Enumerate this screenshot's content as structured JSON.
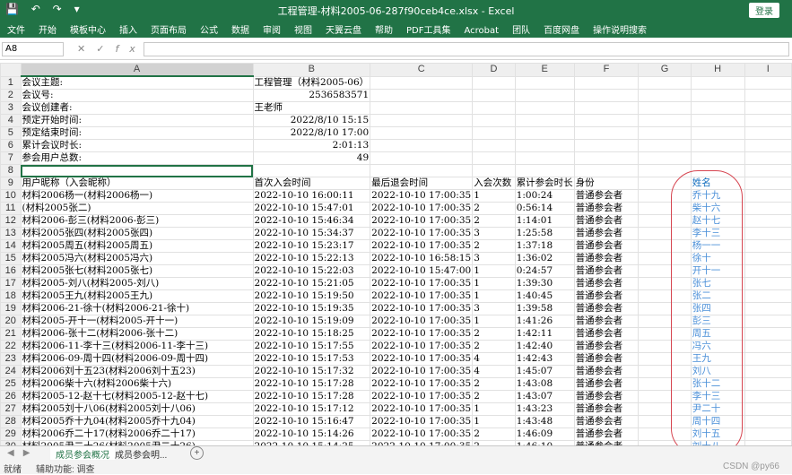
{
  "window": {
    "title": "工程管理-材料2005-06-287f90ceb4ce.xlsx  -  Excel",
    "login_label": "登录",
    "qa_icons": [
      "save-icon",
      "undo-icon",
      "redo-icon",
      "customize-icon"
    ]
  },
  "ribbon": {
    "tabs": [
      "文件",
      "开始",
      "模板中心",
      "插入",
      "页面布局",
      "公式",
      "数据",
      "审阅",
      "视图",
      "天翼云盘",
      "帮助",
      "PDF工具集",
      "Acrobat",
      "团队",
      "百度网盘",
      "操作说明搜索"
    ]
  },
  "formula_bar": {
    "name_box": "A8",
    "formula": ""
  },
  "columns": [
    "A",
    "B",
    "C",
    "D",
    "E",
    "F",
    "G",
    "H",
    "I"
  ],
  "rows": [
    {
      "n": "1",
      "A": "会议主题:",
      "B": "工程管理（材料2005-06）",
      "C": "",
      "D": "",
      "E": "",
      "F": "",
      "H": ""
    },
    {
      "n": "2",
      "A": "会议号:",
      "B": "2536583571",
      "C": "",
      "D": "",
      "E": "",
      "F": "",
      "H": ""
    },
    {
      "n": "3",
      "A": "会议创建者:",
      "B": "王老师",
      "C": "",
      "D": "",
      "E": "",
      "F": "",
      "H": ""
    },
    {
      "n": "4",
      "A": "预定开始时间:",
      "B": "2022/8/10 15:15",
      "C": "",
      "D": "",
      "E": "",
      "F": "",
      "H": ""
    },
    {
      "n": "5",
      "A": "预定结束时间:",
      "B": "2022/8/10 17:00",
      "C": "",
      "D": "",
      "E": "",
      "F": "",
      "H": ""
    },
    {
      "n": "6",
      "A": "累计会议时长:",
      "B": "2:01:13",
      "C": "",
      "D": "",
      "E": "",
      "F": "",
      "H": ""
    },
    {
      "n": "7",
      "A": "参会用户总数:",
      "B": "49",
      "C": "",
      "D": "",
      "E": "",
      "F": "",
      "H": ""
    },
    {
      "n": "8",
      "A": "",
      "B": "",
      "C": "",
      "D": "",
      "E": "",
      "F": "",
      "H": ""
    },
    {
      "n": "9",
      "A": "用户昵称（入会昵称）",
      "B": "首次入会时间",
      "C": "最后退会时间",
      "D": "入会次数",
      "E": "累计参会时长",
      "F": "身份",
      "H": "姓名"
    },
    {
      "n": "10",
      "A": "材料2006杨一(材料2006杨一)",
      "B": "2022-10-10 16:00:11",
      "C": "2022-10-10 17:00:35",
      "D": "1",
      "E": "1:00:24",
      "F": "普通参会者",
      "H": "乔十九"
    },
    {
      "n": "11",
      "A": "(材料2005张二)",
      "B": "2022-10-10 15:47:01",
      "C": "2022-10-10 17:00:35",
      "D": "2",
      "E": "0:56:14",
      "F": "普通参会者",
      "H": "柴十六"
    },
    {
      "n": "12",
      "A": "材料2006-彭三(材料2006-彭三)",
      "B": "2022-10-10 15:46:34",
      "C": "2022-10-10 17:00:35",
      "D": "2",
      "E": "1:14:01",
      "F": "普通参会者",
      "H": "赵十七"
    },
    {
      "n": "13",
      "A": "材料2005张四(材料2005张四)",
      "B": "2022-10-10 15:34:37",
      "C": "2022-10-10 17:00:35",
      "D": "3",
      "E": "1:25:58",
      "F": "普通参会者",
      "H": "李十三"
    },
    {
      "n": "14",
      "A": "材料2005周五(材料2005周五)",
      "B": "2022-10-10 15:23:17",
      "C": "2022-10-10 17:00:35",
      "D": "2",
      "E": "1:37:18",
      "F": "普通参会者",
      "H": "杨一一"
    },
    {
      "n": "15",
      "A": "材料2005冯六(材料2005冯六)",
      "B": "2022-10-10 15:22:13",
      "C": "2022-10-10 16:58:15",
      "D": "3",
      "E": "1:36:02",
      "F": "普通参会者",
      "H": "徐十"
    },
    {
      "n": "16",
      "A": "材料2005张七(材料2005张七)",
      "B": "2022-10-10 15:22:03",
      "C": "2022-10-10 15:47:00",
      "D": "1",
      "E": "0:24:57",
      "F": "普通参会者",
      "H": "开十一"
    },
    {
      "n": "17",
      "A": "材料2005-刘八(材料2005-刘八)",
      "B": "2022-10-10 15:21:05",
      "C": "2022-10-10 17:00:35",
      "D": "1",
      "E": "1:39:30",
      "F": "普通参会者",
      "H": "张七"
    },
    {
      "n": "18",
      "A": "材料2005王九(材料2005王九)",
      "B": "2022-10-10 15:19:50",
      "C": "2022-10-10 17:00:35",
      "D": "1",
      "E": "1:40:45",
      "F": "普通参会者",
      "H": "张二"
    },
    {
      "n": "19",
      "A": "材料2006-21-徐十(材料2006-21-徐十)",
      "B": "2022-10-10 15:19:35",
      "C": "2022-10-10 17:00:35",
      "D": "3",
      "E": "1:39:58",
      "F": "普通参会者",
      "H": "张四"
    },
    {
      "n": "20",
      "A": "材料2005-开十一(材料2005-开十一)",
      "B": "2022-10-10 15:19:09",
      "C": "2022-10-10 17:00:35",
      "D": "1",
      "E": "1:41:26",
      "F": "普通参会者",
      "H": "彭三"
    },
    {
      "n": "21",
      "A": "材料2006-张十二(材料2006-张十二)",
      "B": "2022-10-10 15:18:25",
      "C": "2022-10-10 17:00:35",
      "D": "2",
      "E": "1:42:11",
      "F": "普通参会者",
      "H": "周五"
    },
    {
      "n": "22",
      "A": "材料2006-11-李十三(材料2006-11-李十三)",
      "B": "2022-10-10 15:17:55",
      "C": "2022-10-10 17:00:35",
      "D": "2",
      "E": "1:42:40",
      "F": "普通参会者",
      "H": "冯六"
    },
    {
      "n": "23",
      "A": "材料2006-09-周十四(材料2006-09-周十四)",
      "B": "2022-10-10 15:17:53",
      "C": "2022-10-10 17:00:35",
      "D": "4",
      "E": "1:42:43",
      "F": "普通参会者",
      "H": "王九"
    },
    {
      "n": "24",
      "A": "材料2006刘十五23(材料2006刘十五23)",
      "B": "2022-10-10 15:17:32",
      "C": "2022-10-10 17:00:35",
      "D": "4",
      "E": "1:45:07",
      "F": "普通参会者",
      "H": "刘八"
    },
    {
      "n": "25",
      "A": "材料2006柴十六(材料2006柴十六)",
      "B": "2022-10-10 15:17:28",
      "C": "2022-10-10 17:00:35",
      "D": "2",
      "E": "1:43:08",
      "F": "普通参会者",
      "H": "张十二"
    },
    {
      "n": "26",
      "A": "材料2005-12-赵十七(材料2005-12-赵十七)",
      "B": "2022-10-10 15:17:28",
      "C": "2022-10-10 17:00:35",
      "D": "2",
      "E": "1:43:07",
      "F": "普通参会者",
      "H": "李十三"
    },
    {
      "n": "27",
      "A": "材料2005刘十八06(材料2005刘十八06)",
      "B": "2022-10-10 15:17:12",
      "C": "2022-10-10 17:00:35",
      "D": "1",
      "E": "1:43:23",
      "F": "普通参会者",
      "H": "尹二十"
    },
    {
      "n": "28",
      "A": "材料2005乔十九04(材料2005乔十九04)",
      "B": "2022-10-10 15:16:47",
      "C": "2022-10-10 17:00:35",
      "D": "1",
      "E": "1:43:48",
      "F": "普通参会者",
      "H": "周十四"
    },
    {
      "n": "29",
      "A": "材料2006乔二十17(材料2006乔二十17)",
      "B": "2022-10-10 15:14:26",
      "C": "2022-10-10 17:00:35",
      "D": "2",
      "E": "1:46:09",
      "F": "普通参会者",
      "H": "刘十五"
    },
    {
      "n": "30",
      "A": "材料2005尹二十26(材料2005尹二十26)",
      "B": "2022-10-10 15:14:25",
      "C": "2022-10-10 17:00:35",
      "D": "2",
      "E": "1:46:10",
      "F": "普通参会者",
      "H": "刘十八"
    }
  ],
  "sheet_tabs": {
    "active": "成员参会概况",
    "other": "成员参会明..."
  },
  "status": {
    "mode": "就绪",
    "accessibility": "辅助功能: 调查",
    "watermark": "CSDN @py66"
  }
}
